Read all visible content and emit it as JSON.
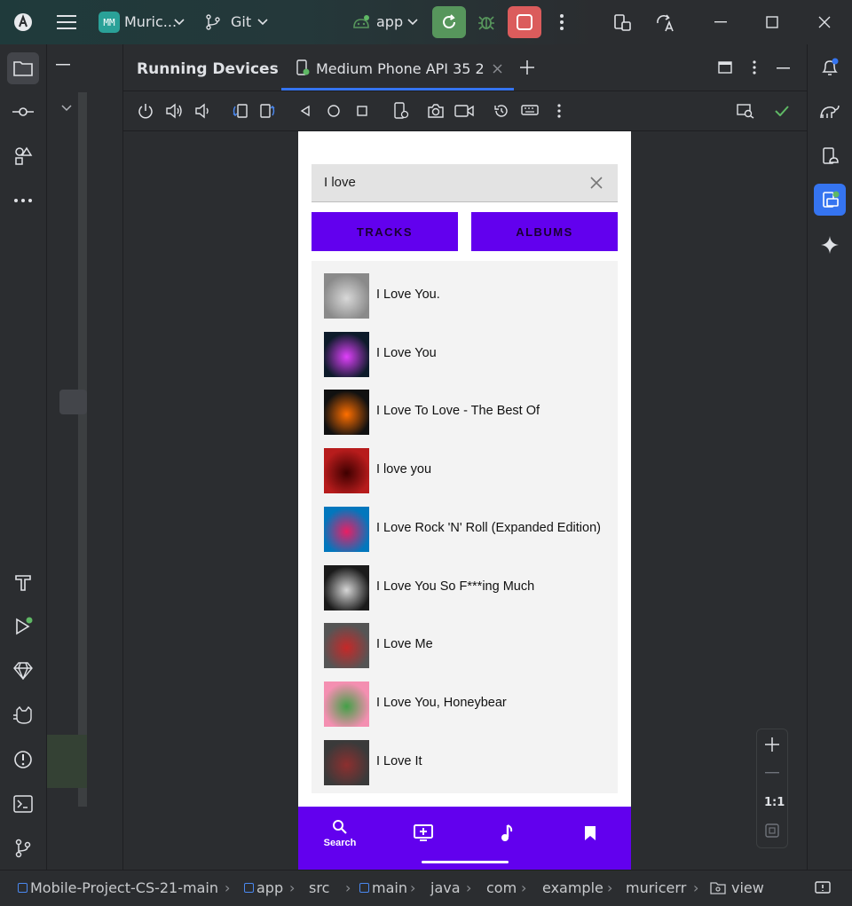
{
  "titlebar": {
    "project_badge": "MM",
    "project_name": "Muric...",
    "vcs_label": "Git",
    "run_config": "app"
  },
  "tool_window": {
    "title": "Running Devices",
    "tab_label": "Medium Phone API 35 2"
  },
  "phone": {
    "search_value": "I love",
    "buttons": {
      "tracks": "TRACKS",
      "albums": "ALBUMS"
    },
    "results": [
      {
        "title": "I Love You.",
        "art_colors": [
          "#8a8a8a",
          "#d8d8d8"
        ]
      },
      {
        "title": "I Love You",
        "art_colors": [
          "#0d1b2a",
          "#e040fb"
        ]
      },
      {
        "title": "I Love To Love - The Best Of",
        "art_colors": [
          "#111111",
          "#ff6f00"
        ]
      },
      {
        "title": "I love you",
        "art_colors": [
          "#b71c1c",
          "#3e0000"
        ]
      },
      {
        "title": "I Love Rock 'N' Roll (Expanded Edition)",
        "art_colors": [
          "#0277bd",
          "#e91e63"
        ]
      },
      {
        "title": "I Love You So F***ing Much",
        "art_colors": [
          "#1b1b1b",
          "#d6d6d6"
        ]
      },
      {
        "title": "I Love Me",
        "art_colors": [
          "#555555",
          "#c62828"
        ]
      },
      {
        "title": "I Love You, Honeybear",
        "art_colors": [
          "#f48fb1",
          "#43a047"
        ]
      },
      {
        "title": "I Love It",
        "art_colors": [
          "#3a3a3a",
          "#8d2f2f"
        ]
      }
    ],
    "bottom_nav": {
      "search_label": "Search"
    },
    "accent_color": "#6200ee"
  },
  "zoom": {
    "ratio_label": "1:1"
  },
  "breadcrumbs": [
    "Mobile-Project-CS-21-main",
    "app",
    "src",
    "main",
    "java",
    "com",
    "example",
    "muricerr",
    "view"
  ]
}
